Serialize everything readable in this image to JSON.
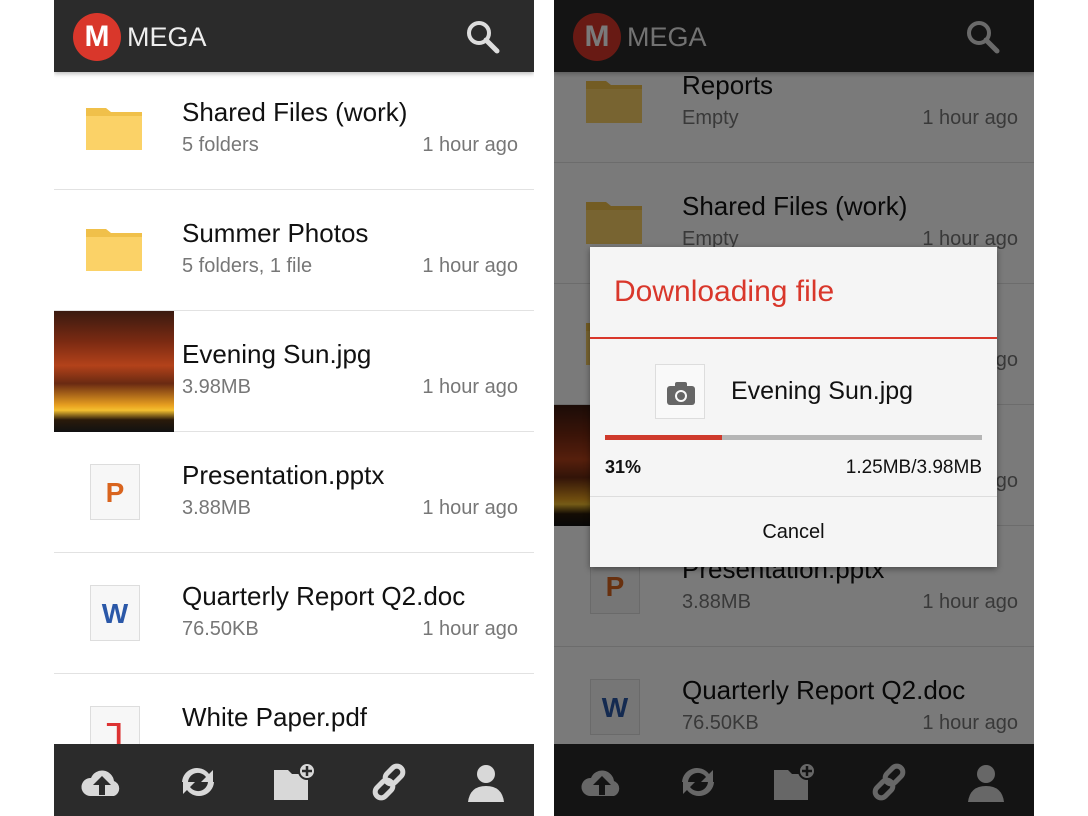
{
  "app": {
    "title": "MEGA",
    "logo_letter": "M",
    "accent": "#d9372b"
  },
  "left": {
    "rows": [
      {
        "type": "folder",
        "title": "Shared Files (work)",
        "sub": "5 folders",
        "time": "1 hour ago"
      },
      {
        "type": "folder",
        "title": "Summer Photos",
        "sub": "5 folders, 1 file",
        "time": "1 hour ago"
      },
      {
        "type": "image",
        "title": "Evening Sun.jpg",
        "sub": "3.98MB",
        "time": "1 hour ago"
      },
      {
        "type": "pptx",
        "title": "Presentation.pptx",
        "sub": "3.88MB",
        "time": "1 hour ago"
      },
      {
        "type": "doc",
        "title": "Quarterly Report Q2.doc",
        "sub": "76.50KB",
        "time": "1 hour ago"
      },
      {
        "type": "pdf",
        "title": "White Paper.pdf"
      }
    ]
  },
  "right": {
    "rows": [
      {
        "type": "folder",
        "title": "Reports",
        "sub": "Empty",
        "time": "1 hour ago"
      },
      {
        "type": "folder",
        "title": "Shared Files (work)",
        "sub": "Empty",
        "time": "1 hour ago"
      },
      {
        "type": "folder",
        "time": "1 hour ago"
      },
      {
        "type": "image",
        "time": "1 hour ago"
      },
      {
        "type": "pptx",
        "title": "Presentation.pptx",
        "sub": "3.88MB",
        "time": "1 hour ago"
      },
      {
        "type": "doc",
        "title": "Quarterly Report Q2.doc",
        "sub": "76.50KB",
        "time": "1 hour ago"
      }
    ]
  },
  "dialog": {
    "title": "Downloading file",
    "filename": "Evening Sun.jpg",
    "progress_percent": 31,
    "progress_label": "31%",
    "size_label": "1.25MB/3.98MB",
    "cancel_label": "Cancel",
    "progress_color": "#cf3a2c"
  },
  "bottom_bar": {
    "icons": [
      "cloud-upload-icon",
      "sync-icon",
      "new-folder-icon",
      "link-icon",
      "account-icon"
    ]
  }
}
